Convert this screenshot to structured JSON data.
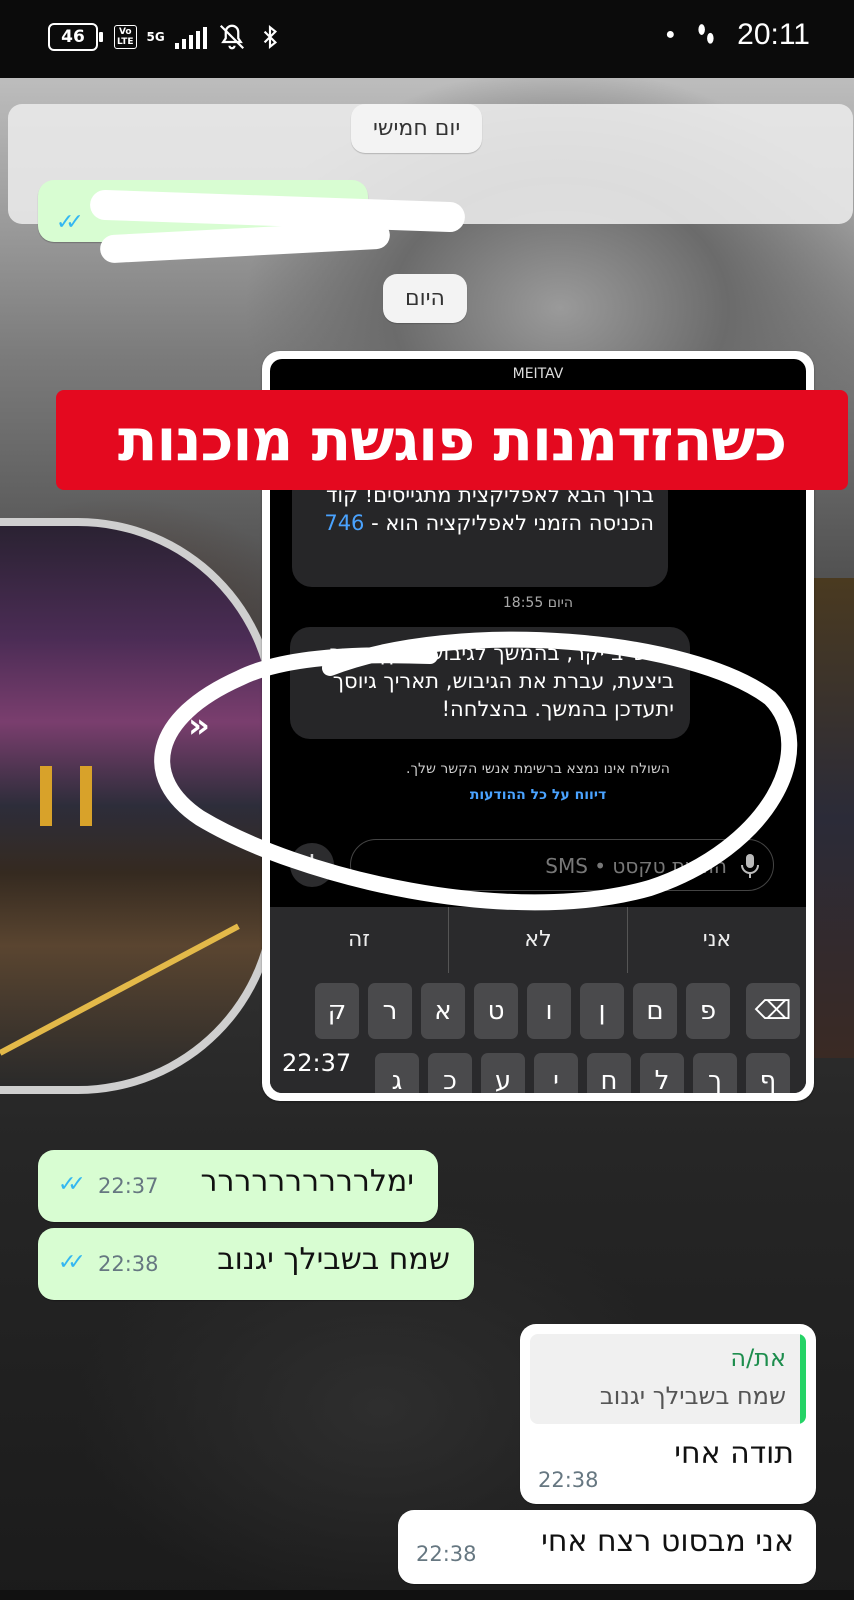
{
  "status_bar": {
    "battery": "46",
    "volte": "Vo\nLTE",
    "network": "5G",
    "time": "20:11"
  },
  "chat": {
    "date_pill_1": "יום חמישי",
    "date_pill_2": "היום",
    "image_message": {
      "banner": "כשהזדמנות פוגשת מוכנות",
      "sms_header": "MEITAV",
      "sms_msg_1": "ברוך הבא לאפליקצית מתגייסים! קוד הכניסה הזמני לאפליקציה הוא -",
      "sms_code": "746",
      "sms_day_time": "היום 18:55",
      "sms_msg_2": "מלש\"ב יקר, בהמשך לגיבוש עוקץ אשר ביצעת, עברת את הגיבוש, תאריך גיוסך יתעדכן בהמשך. בהצלחה!",
      "sms_notice": "השולח אינו נמצא ברשימת אנשי הקשר שלך.",
      "sms_report": "דיווח על כל ההודעות",
      "sms_input_placeholder": "הודעת טקסט • SMS",
      "suggestions": [
        "אני",
        "לא",
        "זה"
      ],
      "keys_row1": [
        "פ",
        "ם",
        "ן",
        "ו",
        "ט",
        "א",
        "ר",
        "ק"
      ],
      "keys_row2": [
        "ף",
        "ך",
        "ל",
        "ח",
        "י",
        "ע",
        "כ",
        "ג"
      ],
      "time": "22:37"
    },
    "out_msg_1": {
      "text": "ימלרררררררררר",
      "time": "22:37"
    },
    "out_msg_2": {
      "text": "שמח בשבילך יגנוב",
      "time": "22:38"
    },
    "in_msg_1": {
      "quote_author": "את/ה",
      "quote_text": "שמח בשבילך יגנוב",
      "text": "תודה אחי",
      "time": "22:38"
    },
    "in_msg_2": {
      "text": "אני מבסוט רצח אחי",
      "time": "22:38"
    }
  },
  "colors": {
    "outgoing_bubble": "#d8fdd2",
    "incoming_bubble": "#ffffff",
    "banner_red": "#e4091f",
    "read_ticks": "#34b7f1"
  }
}
